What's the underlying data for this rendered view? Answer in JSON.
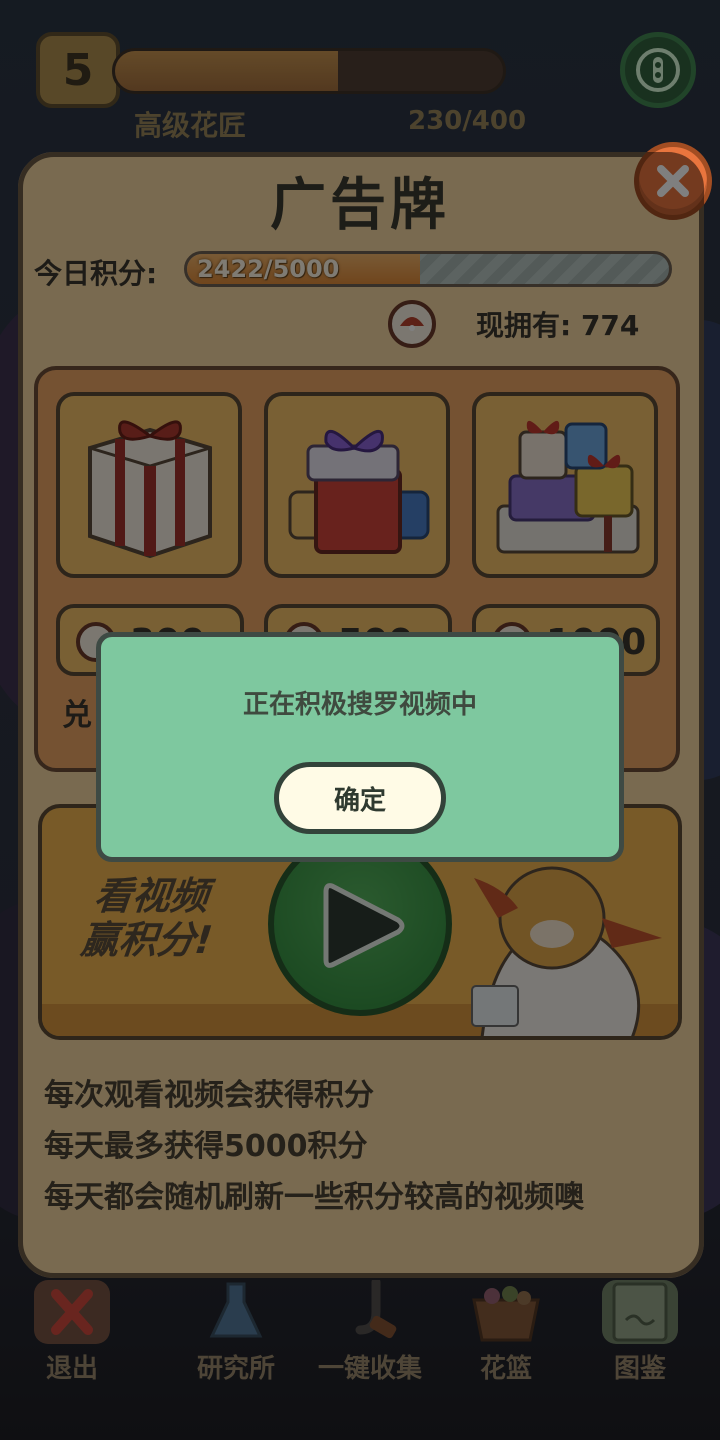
{
  "hud": {
    "level": "5",
    "rank_name": "高级花匠",
    "xp_text": "230/400",
    "xp_progress": 0.575
  },
  "panel": {
    "title": "广告牌",
    "score_label": "今日积分:",
    "score_text": "2422/5000",
    "score_progress": 0.4844,
    "owned_label": "现拥有:",
    "owned_value": "774",
    "owned_text": "现拥有: 774",
    "shop": {
      "redeem_label": "兑",
      "items": [
        {
          "icon": "gift-box-small-icon",
          "price": "300"
        },
        {
          "icon": "gift-box-medium-icon",
          "price": "500"
        },
        {
          "icon": "gift-box-large-icon",
          "price": "1000"
        }
      ]
    },
    "video": {
      "line1": "看视频",
      "line2": "赢积分!"
    },
    "rules": [
      "每次观看视频会获得积分",
      "每天最多获得5000积分",
      "每天都会随机刷新一些积分较高的视频噢"
    ]
  },
  "dialog": {
    "message": "正在积极搜罗视频中",
    "confirm_label": "确定"
  },
  "bottom_nav": [
    {
      "label": "退出",
      "icon": "exit-x-icon"
    },
    {
      "label": "研究所",
      "icon": "flask-icon"
    },
    {
      "label": "一键收集",
      "icon": "collect-hook-icon"
    },
    {
      "label": "花篮",
      "icon": "basket-icon"
    },
    {
      "label": "图鉴",
      "icon": "book-icon"
    }
  ],
  "colors": {
    "panel_bg": "#f3d5a0",
    "dialog_bg": "#7ec89f",
    "close_button": "#e9753e",
    "play_button": "#3f9e4a"
  }
}
